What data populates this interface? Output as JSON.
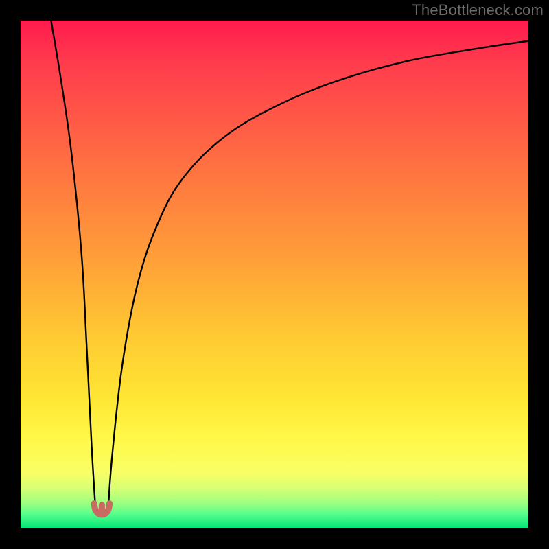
{
  "attribution": "TheBottleneck.com",
  "chart_data": {
    "type": "line",
    "title": "",
    "xlabel": "",
    "ylabel": "",
    "xlim": [
      0,
      100
    ],
    "ylim": [
      0,
      100
    ],
    "gradient_stops": [
      {
        "pos": 0,
        "color": "#ff1a4d"
      },
      {
        "pos": 8,
        "color": "#ff3b4d"
      },
      {
        "pos": 18,
        "color": "#ff5547"
      },
      {
        "pos": 33,
        "color": "#ff7c3f"
      },
      {
        "pos": 48,
        "color": "#ffa238"
      },
      {
        "pos": 62,
        "color": "#ffc933"
      },
      {
        "pos": 74,
        "color": "#ffe533"
      },
      {
        "pos": 83,
        "color": "#fff94a"
      },
      {
        "pos": 89,
        "color": "#f8ff66"
      },
      {
        "pos": 92,
        "color": "#d8ff73"
      },
      {
        "pos": 95,
        "color": "#9eff80"
      },
      {
        "pos": 97,
        "color": "#5cff8c"
      },
      {
        "pos": 100,
        "color": "#00e676"
      }
    ],
    "series": [
      {
        "name": "left-branch",
        "x": [
          6,
          8,
          10,
          12,
          13,
          14,
          14.8
        ],
        "y": [
          100,
          88,
          74,
          54,
          36,
          16,
          3
        ]
      },
      {
        "name": "right-branch",
        "x": [
          17.2,
          18,
          20,
          23,
          27,
          32,
          40,
          50,
          62,
          76,
          90,
          100
        ],
        "y": [
          3,
          14,
          32,
          48,
          60,
          69,
          77,
          83,
          88,
          92,
          94.5,
          96
        ]
      }
    ],
    "trough_marker": {
      "x_range": [
        14.5,
        17.5
      ],
      "y": 2.5,
      "color": "#c76b63"
    }
  }
}
